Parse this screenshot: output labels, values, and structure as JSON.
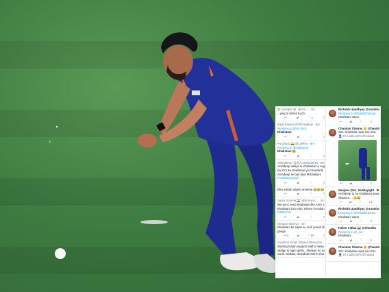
{
  "photo": {
    "colors": {
      "grass": "#4a8a4c",
      "kit_blue": "#22309a",
      "kit_orange": "#e86a2a",
      "ball": "#ffffff"
    }
  },
  "left_panel": {
    "tweets": [
      {
        "lines": [
          "🏏 ɐɯɐʞɐɐ 🏏 @iAm... · 3m",
          "...ying to @ANI Koch"
        ],
        "actions": [
          "",
          "",
          "1",
          ""
        ]
      },
      {
        "lines": [
          "Bajaj Biryani @FtkhingBaje · 8m",
          "Replying to @vfc dont",
          "Khalistani"
        ],
        "actions": [
          "",
          "",
          "",
          ""
        ]
      },
      {
        "lines": [
          "Pocahara 🇮🇳 @LolR84 · 9m",
          "Replying to @natdrama",
          "Khalistani 😡"
        ],
        "actions": [
          "",
          "",
          "",
          ""
        ]
      },
      {
        "lines": [
          "Shikhakhay @@Ar1b3rid1M18 · 9m",
          "Arshdeep vadiya ki Khalistani to ought se hara",
          "hai Grrr ko Khalistani ye Khandal ki",
          "Arshdeep se bari diya #Khalistani",
          "#Arshdeepsingh"
        ],
        "actions": [
          "",
          "",
          "",
          ""
        ]
      },
      {
        "lines": [
          "Bhai sahab aapne arsdeep 😂😂😂"
        ],
        "actions": [
          "",
          "",
          "",
          ""
        ]
      },
      {
        "lines": [
          "Sajan Sharma 🇮🇳 @Bronyon... · 4m",
          "We don't need Khalistani like Arsh. Deep",
          "Khalistani Line Aan. Kheen in Indian team.",
          "#INDvPAK"
        ],
        "actions": [
          "",
          "",
          "",
          ""
        ]
      },
      {
        "lines": [
          "Shrayon Bharya · 4m",
          "Khalistani ke aajah se louh jehadi ab",
          "ganga"
        ],
        "actions": [
          "4",
          "",
          "80",
          ""
        ]
      },
      {
        "lines": [
          "Sundeep Singh @NaturalDeepSin... · 4m",
          "Starting Indian support staff to keep",
          "sledge in high spirits.. dheleye ho use",
          "Sunil. Gaddar, deshdrohi bolne shuru."
        ],
        "actions": [
          "",
          "",
          "",
          ""
        ]
      }
    ]
  },
  "right_panel": {
    "tweets": [
      {
        "lines": [
          "Rishabh Upadhyay @sur4sha",
          "Replying to @RubalDhaman",
          "Khalistani saver"
        ],
        "actions": [
          "",
          "",
          "",
          ""
        ]
      },
      {
        "lines": [
          "Chandan Sharma 😊 @handd",
          "SIC: Khalistani spot rise Kha",
          "👤 Dr. Ladla @ProfChitdad"
        ],
        "actions": [
          "",
          "",
          "",
          ""
        ],
        "has_embed": true
      },
      {
        "lines": [
          "Sanjeev @Hi_SanNayight · 9m",
          "Arshdeep to be Khalistani saver",
          "Shamen.....🫡😂"
        ],
        "actions": [
          "",
          "",
          "",
          "1"
        ]
      },
      {
        "lines": [
          "Rishabh Upadhyay @sur4shal",
          "Replying to @RubalDhaman",
          "Khalistani saver"
        ],
        "actions": [
          "",
          "",
          "",
          ""
        ]
      },
      {
        "lines": [
          "Fallen 2 Bhai 🇮🇳 @Shonikn",
          "Replying to @_cat",
          "Khalistani"
        ],
        "actions": [
          "",
          "",
          "",
          ""
        ]
      },
      {
        "lines": [
          "Chandan Sharma 😊 @handd",
          "SIC: Khalistani spot rise Kha",
          "👤 Dr. Ladla @ProfChitdad"
        ],
        "actions": [
          "",
          "",
          "",
          ""
        ]
      }
    ]
  }
}
